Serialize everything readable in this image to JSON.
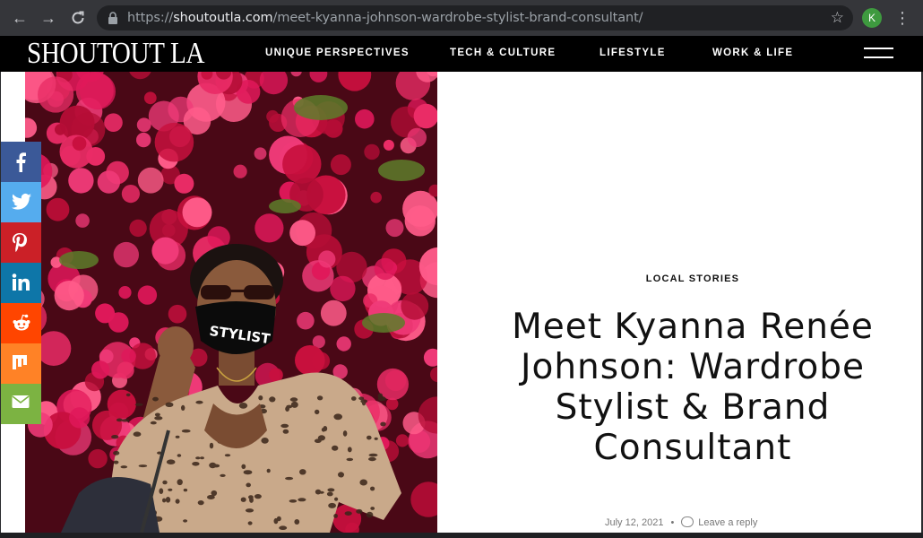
{
  "browser": {
    "url_scheme": "https://",
    "url_domain": "shoutoutla.com",
    "url_path": "/meet-kyanna-johnson-wardrobe-stylist-brand-consultant/",
    "profile_initial": "K"
  },
  "site": {
    "logo": "SHOUTOUT LA",
    "menu": [
      "UNIQUE PERSPECTIVES",
      "TECH & CULTURE",
      "LIFESTYLE",
      "WORK & LIFE"
    ]
  },
  "article": {
    "category": "LOCAL STORIES",
    "title": "Meet Kyanna Renée Johnson: Wardrobe Stylist & Brand Consultant",
    "date": "July 12, 2021",
    "reply_label": "Leave a reply",
    "mask_text": "STYLIST"
  },
  "social": [
    {
      "icon": "facebook-icon",
      "color": "#3b5998"
    },
    {
      "icon": "twitter-icon",
      "color": "#55acee"
    },
    {
      "icon": "pinterest-icon",
      "color": "#cb2027"
    },
    {
      "icon": "linkedin-icon",
      "color": "#0e76a8"
    },
    {
      "icon": "reddit-icon",
      "color": "#ff4500"
    },
    {
      "icon": "mix-icon",
      "color": "#ff8226"
    },
    {
      "icon": "email-icon",
      "color": "#7cb342"
    }
  ],
  "colors": {
    "site_header": "#000000",
    "browser_chrome": "#35363a",
    "title_text": "#111111"
  }
}
